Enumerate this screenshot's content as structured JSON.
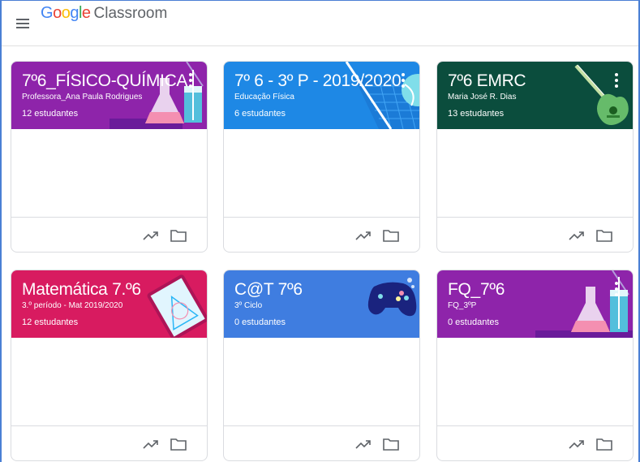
{
  "app": {
    "logo_google_letters": [
      "G",
      "o",
      "o",
      "g",
      "l",
      "e"
    ],
    "logo_google_colors": [
      "#4285f4",
      "#ea4335",
      "#fbbc05",
      "#4285f4",
      "#34a853",
      "#ea4335"
    ],
    "logo_classroom": "Classroom"
  },
  "icons": {
    "menu": "hamburger-menu-icon",
    "more": "more-vert-icon",
    "trend": "trending-up-icon",
    "folder": "folder-icon"
  },
  "cards": [
    {
      "title": "7º6_FÍSICO-QUÍMICA",
      "subtitle": "Professora_Ana Paula Rodrigues",
      "students": "12 estudantes",
      "color": "#8e24aa",
      "illustration": "science-flask"
    },
    {
      "title": "7º 6 - 3º P - 2019/2020",
      "subtitle": "Educação Física",
      "students": "6 estudantes",
      "color": "#1e88e5",
      "illustration": "tennis"
    },
    {
      "title": "7º6 EMRC",
      "subtitle": "Maria José R. Dias",
      "students": "13 estudantes",
      "color": "#0b4d3d",
      "illustration": "guitar"
    },
    {
      "title": "Matemática 7.º6",
      "subtitle": "3.º período - Mat 2019/2020",
      "students": "12 estudantes",
      "color": "#d81b60",
      "illustration": "tablet-geometry"
    },
    {
      "title": "C@T 7º6",
      "subtitle": "3º Ciclo",
      "students": "0 estudantes",
      "color": "#3f7de0",
      "illustration": "gamepad"
    },
    {
      "title": "FQ_7º6",
      "subtitle": "FQ_3ºP",
      "students": "0 estudantes",
      "color": "#8e24aa",
      "illustration": "science-flask"
    }
  ]
}
